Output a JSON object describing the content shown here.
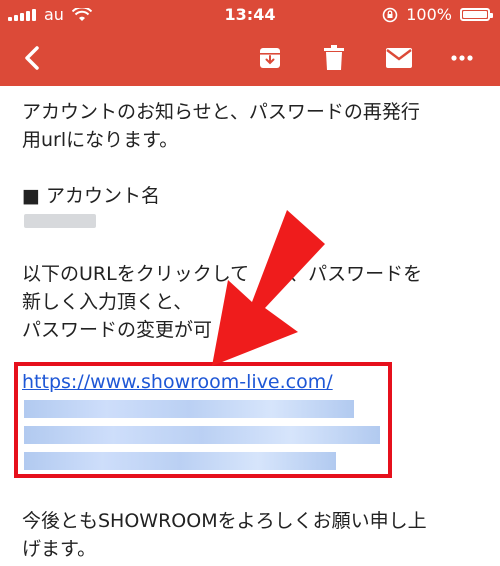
{
  "status_bar": {
    "carrier": "au",
    "time": "13:44",
    "battery": "100%"
  },
  "toolbar": {
    "back_icon": "chevron-left-icon",
    "archive_icon": "archive-icon",
    "delete_icon": "trash-icon",
    "mail_icon": "mail-icon",
    "more_icon": "more-horizontal-icon"
  },
  "email": {
    "intro_line1": "アカウントのお知らせと、パスワードの再発行",
    "intro_line2": "用urlになります。",
    "account_heading": "■ アカウント名",
    "instruction_line1": "以下のURLをクリックして",
    "instruction_line1_tail": "、パスワードを",
    "instruction_line2": "新しく入力頂くと、",
    "instruction_line3": "パスワードの変更が可",
    "link": "https://www.showroom-live.com/",
    "closing_line1": "今後ともSHOWROOMをよろしくお願い申し上",
    "closing_line2": "げます。"
  },
  "colors": {
    "appbar": "#dc4a38",
    "highlight_box": "#e6101c",
    "arrow": "#ef1c1c",
    "link": "#1e57d6"
  }
}
